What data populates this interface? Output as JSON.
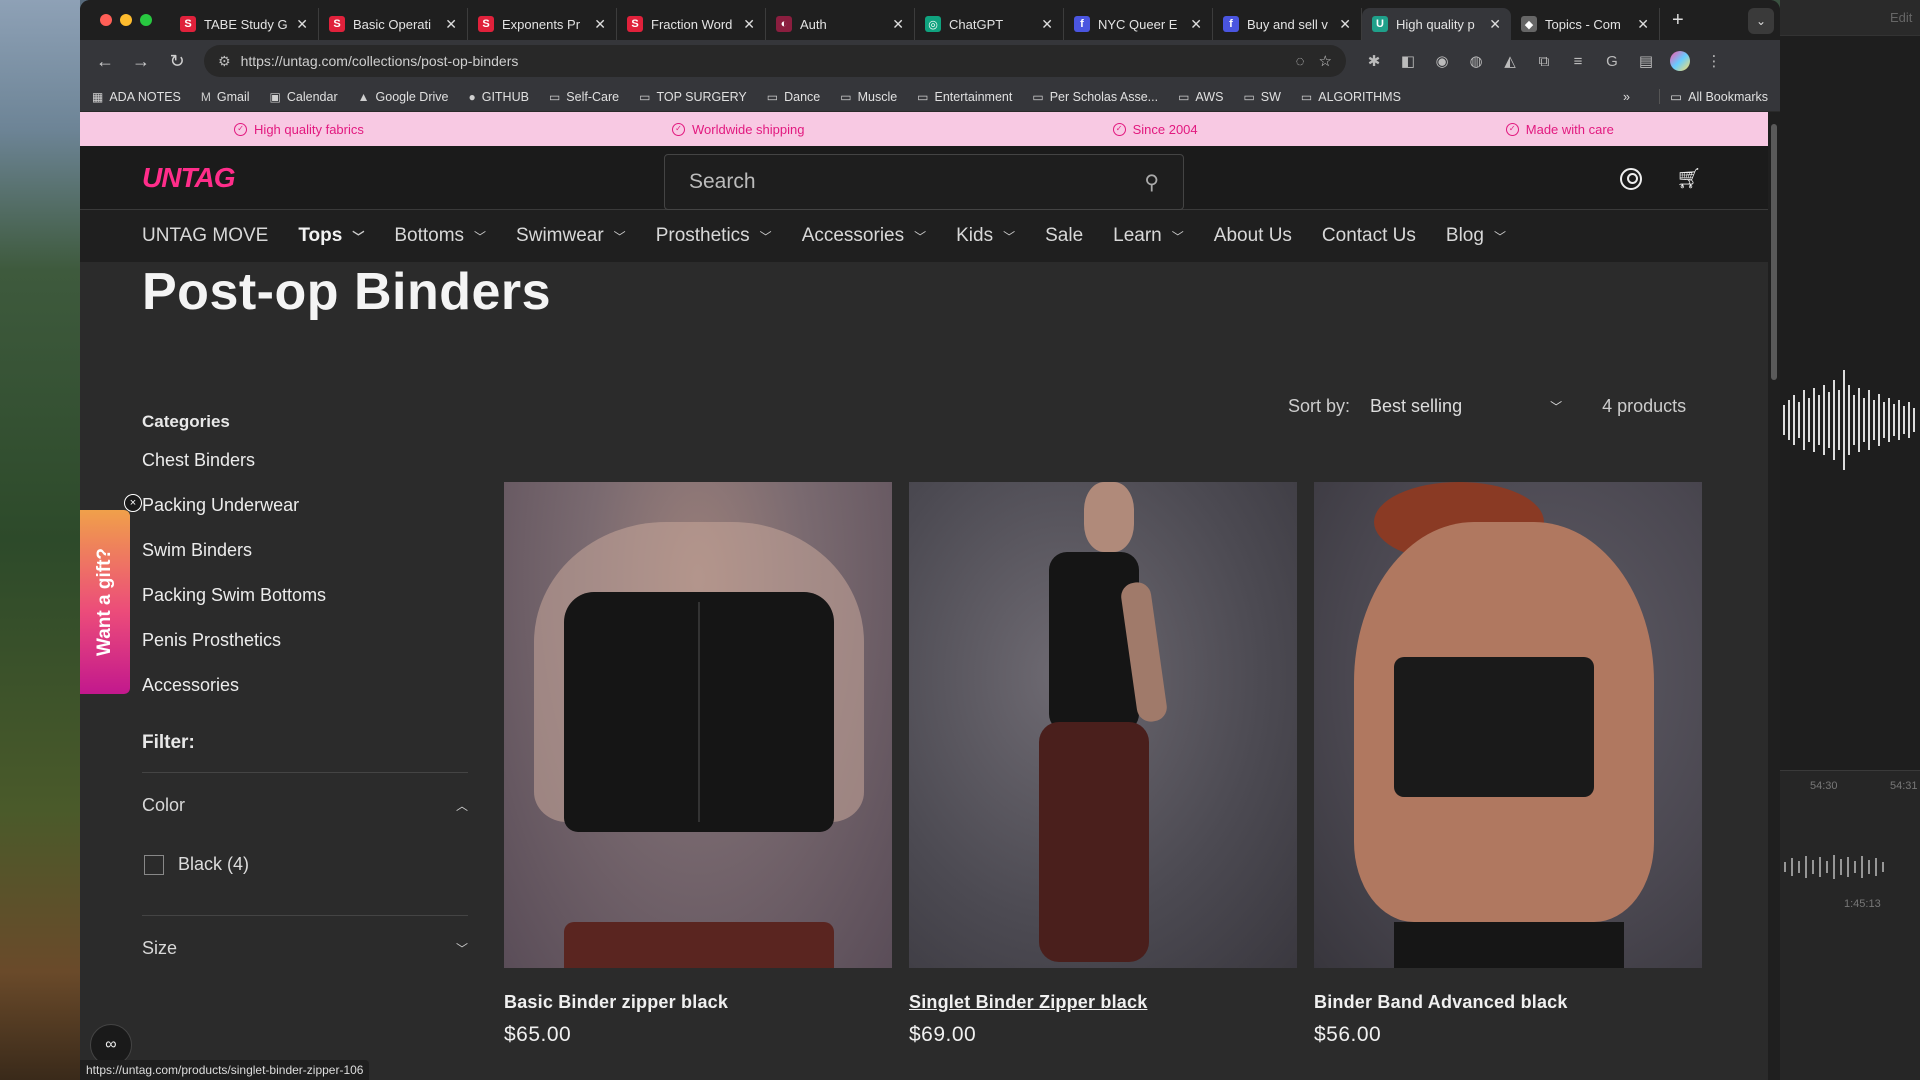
{
  "browser": {
    "tabs": [
      {
        "title": "TABE Study G",
        "favicon": "S",
        "favcolor": "#e0213b"
      },
      {
        "title": "Basic Operati",
        "favicon": "S",
        "favcolor": "#e0213b"
      },
      {
        "title": "Exponents Pr",
        "favicon": "S",
        "favcolor": "#e0213b"
      },
      {
        "title": "Fraction Word",
        "favicon": "S",
        "favcolor": "#e0213b"
      },
      {
        "title": "Auth",
        "favicon": "◐",
        "favcolor": "#8b1e3f"
      },
      {
        "title": "ChatGPT",
        "favicon": "◎",
        "favcolor": "#10a37f"
      },
      {
        "title": "NYC Queer E",
        "favicon": "f",
        "favcolor": "#4a55e0"
      },
      {
        "title": "Buy and sell v",
        "favicon": "f",
        "favcolor": "#4a55e0"
      },
      {
        "title": "High quality p",
        "favicon": "U",
        "favcolor": "#1fa08a"
      },
      {
        "title": "Topics - Com",
        "favicon": "◆",
        "favcolor": "#666"
      }
    ],
    "new_tab": "+",
    "tab_menu": "⌄",
    "url": "https://untag.com/collections/post-op-binders",
    "bookmarks": [
      {
        "label": "ADA NOTES",
        "icon": "▦"
      },
      {
        "label": "Gmail",
        "icon": "M"
      },
      {
        "label": "Calendar",
        "icon": "▣"
      },
      {
        "label": "Google Drive",
        "icon": "▲"
      },
      {
        "label": "GITHUB",
        "icon": "●"
      },
      {
        "label": "Self-Care",
        "icon": "▭"
      },
      {
        "label": "TOP SURGERY",
        "icon": "▭"
      },
      {
        "label": "Dance",
        "icon": "▭"
      },
      {
        "label": "Muscle",
        "icon": "▭"
      },
      {
        "label": "Entertainment",
        "icon": "▭"
      },
      {
        "label": "Per Scholas Asse...",
        "icon": "▭"
      },
      {
        "label": "AWS",
        "icon": "▭"
      },
      {
        "label": "SW",
        "icon": "▭"
      },
      {
        "label": "ALGORITHMS",
        "icon": "▭"
      }
    ],
    "bookmarks_more": "»",
    "all_bookmarks": "All Bookmarks",
    "status_url": "https://untag.com/products/singlet-binder-zipper-106"
  },
  "announce": [
    "High quality fabrics",
    "Worldwide shipping",
    "Since 2004",
    "Made with care"
  ],
  "header": {
    "logo": "UNTAG",
    "search_placeholder": "Search"
  },
  "nav": [
    {
      "label": "UNTAG MOVE",
      "dropdown": false
    },
    {
      "label": "Tops",
      "dropdown": true,
      "bold": true
    },
    {
      "label": "Bottoms",
      "dropdown": true
    },
    {
      "label": "Swimwear",
      "dropdown": true
    },
    {
      "label": "Prosthetics",
      "dropdown": true
    },
    {
      "label": "Accessories",
      "dropdown": true
    },
    {
      "label": "Kids",
      "dropdown": true
    },
    {
      "label": "Sale",
      "dropdown": false
    },
    {
      "label": "Learn",
      "dropdown": true
    },
    {
      "label": "About Us",
      "dropdown": false
    },
    {
      "label": "Contact Us",
      "dropdown": false
    },
    {
      "label": "Blog",
      "dropdown": true
    }
  ],
  "page": {
    "title": "Post-op Binders",
    "sort_label": "Sort by:",
    "sort_value": "Best selling",
    "product_count": "4 products"
  },
  "sidebar": {
    "categories_title": "Categories",
    "categories": [
      "Chest Binders",
      "Packing Underwear",
      "Swim Binders",
      "Packing Swim Bottoms",
      "Penis Prosthetics",
      "Accessories"
    ],
    "filter_title": "Filter:",
    "color_label": "Color",
    "color_option": "Black (4)",
    "size_label": "Size"
  },
  "gift": {
    "label": "Want a gift?",
    "close": "×"
  },
  "products": [
    {
      "name": "Basic Binder zipper black",
      "price": "$65.00"
    },
    {
      "name": "Singlet Binder Zipper black",
      "price": "$69.00"
    },
    {
      "name": "Binder Band Advanced black",
      "price": "$56.00"
    }
  ],
  "right_app": {
    "edit": "Edit",
    "time1": "54:30",
    "time2": "54:31",
    "time3": "1:45:13"
  },
  "colors": {
    "brand": "#ff2d8a",
    "announce_bg": "#f8c9e3",
    "page_bg": "#2b2b2b"
  }
}
